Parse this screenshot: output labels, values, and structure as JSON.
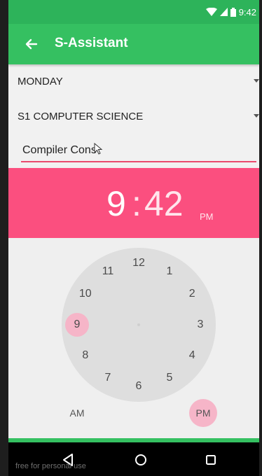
{
  "status_bar": {
    "time": "9:42"
  },
  "app_bar": {
    "title": "S-Assistant"
  },
  "form": {
    "day_spinner": "MONDAY",
    "class_spinner": "S1 COMPUTER SCIENCE",
    "subject_input": "Compiler Cons"
  },
  "time_picker": {
    "hour": "9",
    "colon": ":",
    "minute": "42",
    "period": "PM",
    "selected_hour": 9,
    "hours": [
      "12",
      "1",
      "2",
      "3",
      "4",
      "5",
      "6",
      "7",
      "8",
      "9",
      "10",
      "11"
    ],
    "am_label": "AM",
    "pm_label": "PM"
  },
  "watermark": "free for personal use",
  "colors": {
    "status_green": "#2db35a",
    "appbar_green": "#35c061",
    "header_pink": "#fb4f7f",
    "selection_pink": "#f6b5c8"
  }
}
